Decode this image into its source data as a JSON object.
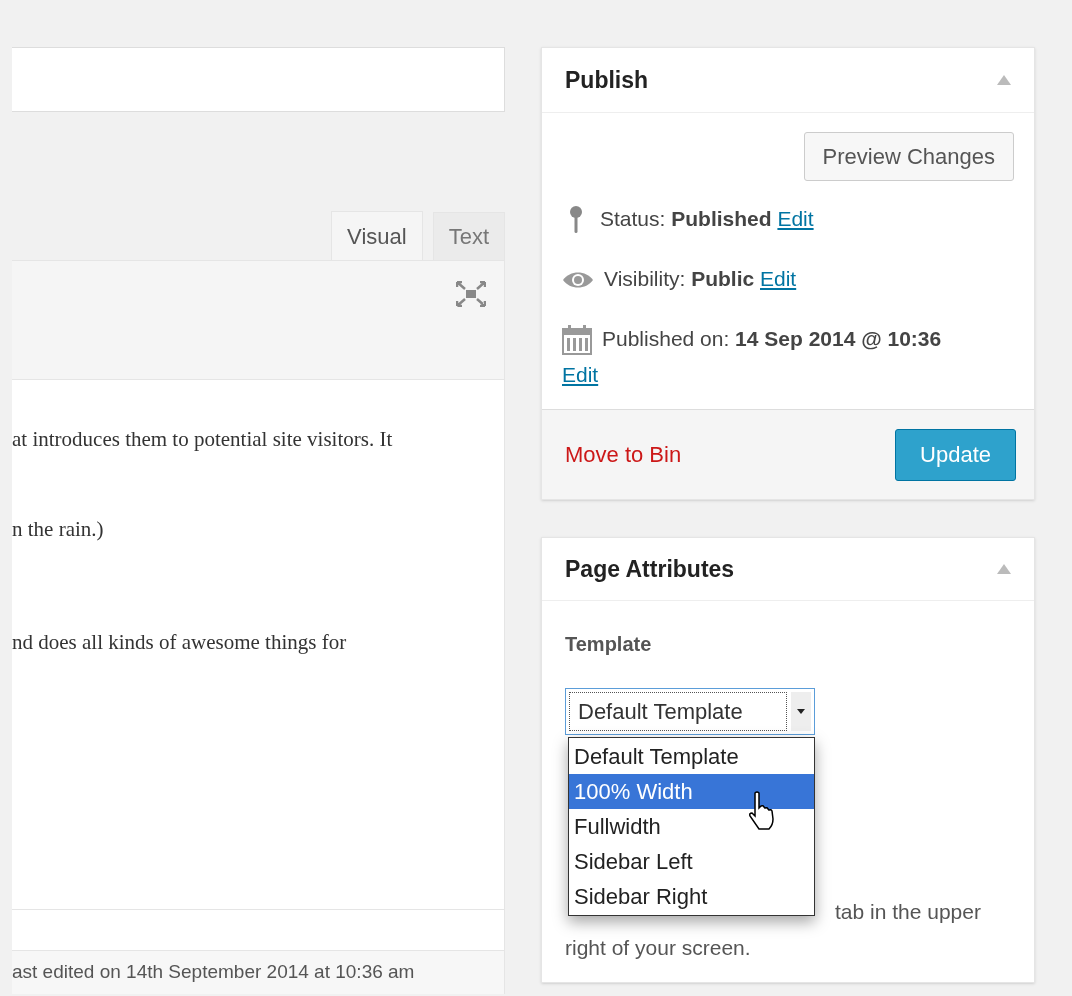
{
  "editor": {
    "tabs": [
      {
        "label": "Visual",
        "selected": true
      },
      {
        "label": "Text",
        "selected": false
      }
    ],
    "lines": [
      "at introduces them to potential site visitors. It",
      "n the rain.)",
      "nd does all kinds of awesome things for"
    ],
    "status": "ast edited on 14th September 2014 at 10:36 am"
  },
  "publish": {
    "title": "Publish",
    "preview_button": "Preview Changes",
    "rows": [
      {
        "kind": "pin",
        "label": "Status:",
        "value": "Published",
        "link": "Edit"
      },
      {
        "kind": "eye",
        "label": "Visibility:",
        "value": "Public",
        "link": "Edit"
      },
      {
        "kind": "calendar",
        "label": "Published on:",
        "value": "14 Sep 2014 @ 10:36",
        "link": "Edit"
      }
    ],
    "trash_link": "Move to Bin",
    "update_button": "Update"
  },
  "page_attributes": {
    "title": "Page Attributes",
    "template_label": "Template",
    "template_value": "Default Template",
    "options": [
      {
        "label": "Default Template",
        "selected": false
      },
      {
        "label": "100% Width",
        "selected": true
      },
      {
        "label": "Fullwidth",
        "selected": false
      },
      {
        "label": "Sidebar Left",
        "selected": false
      },
      {
        "label": "Sidebar Right",
        "selected": false
      }
    ],
    "help_lines": [
      "tab in the upper",
      "right of your screen."
    ]
  }
}
